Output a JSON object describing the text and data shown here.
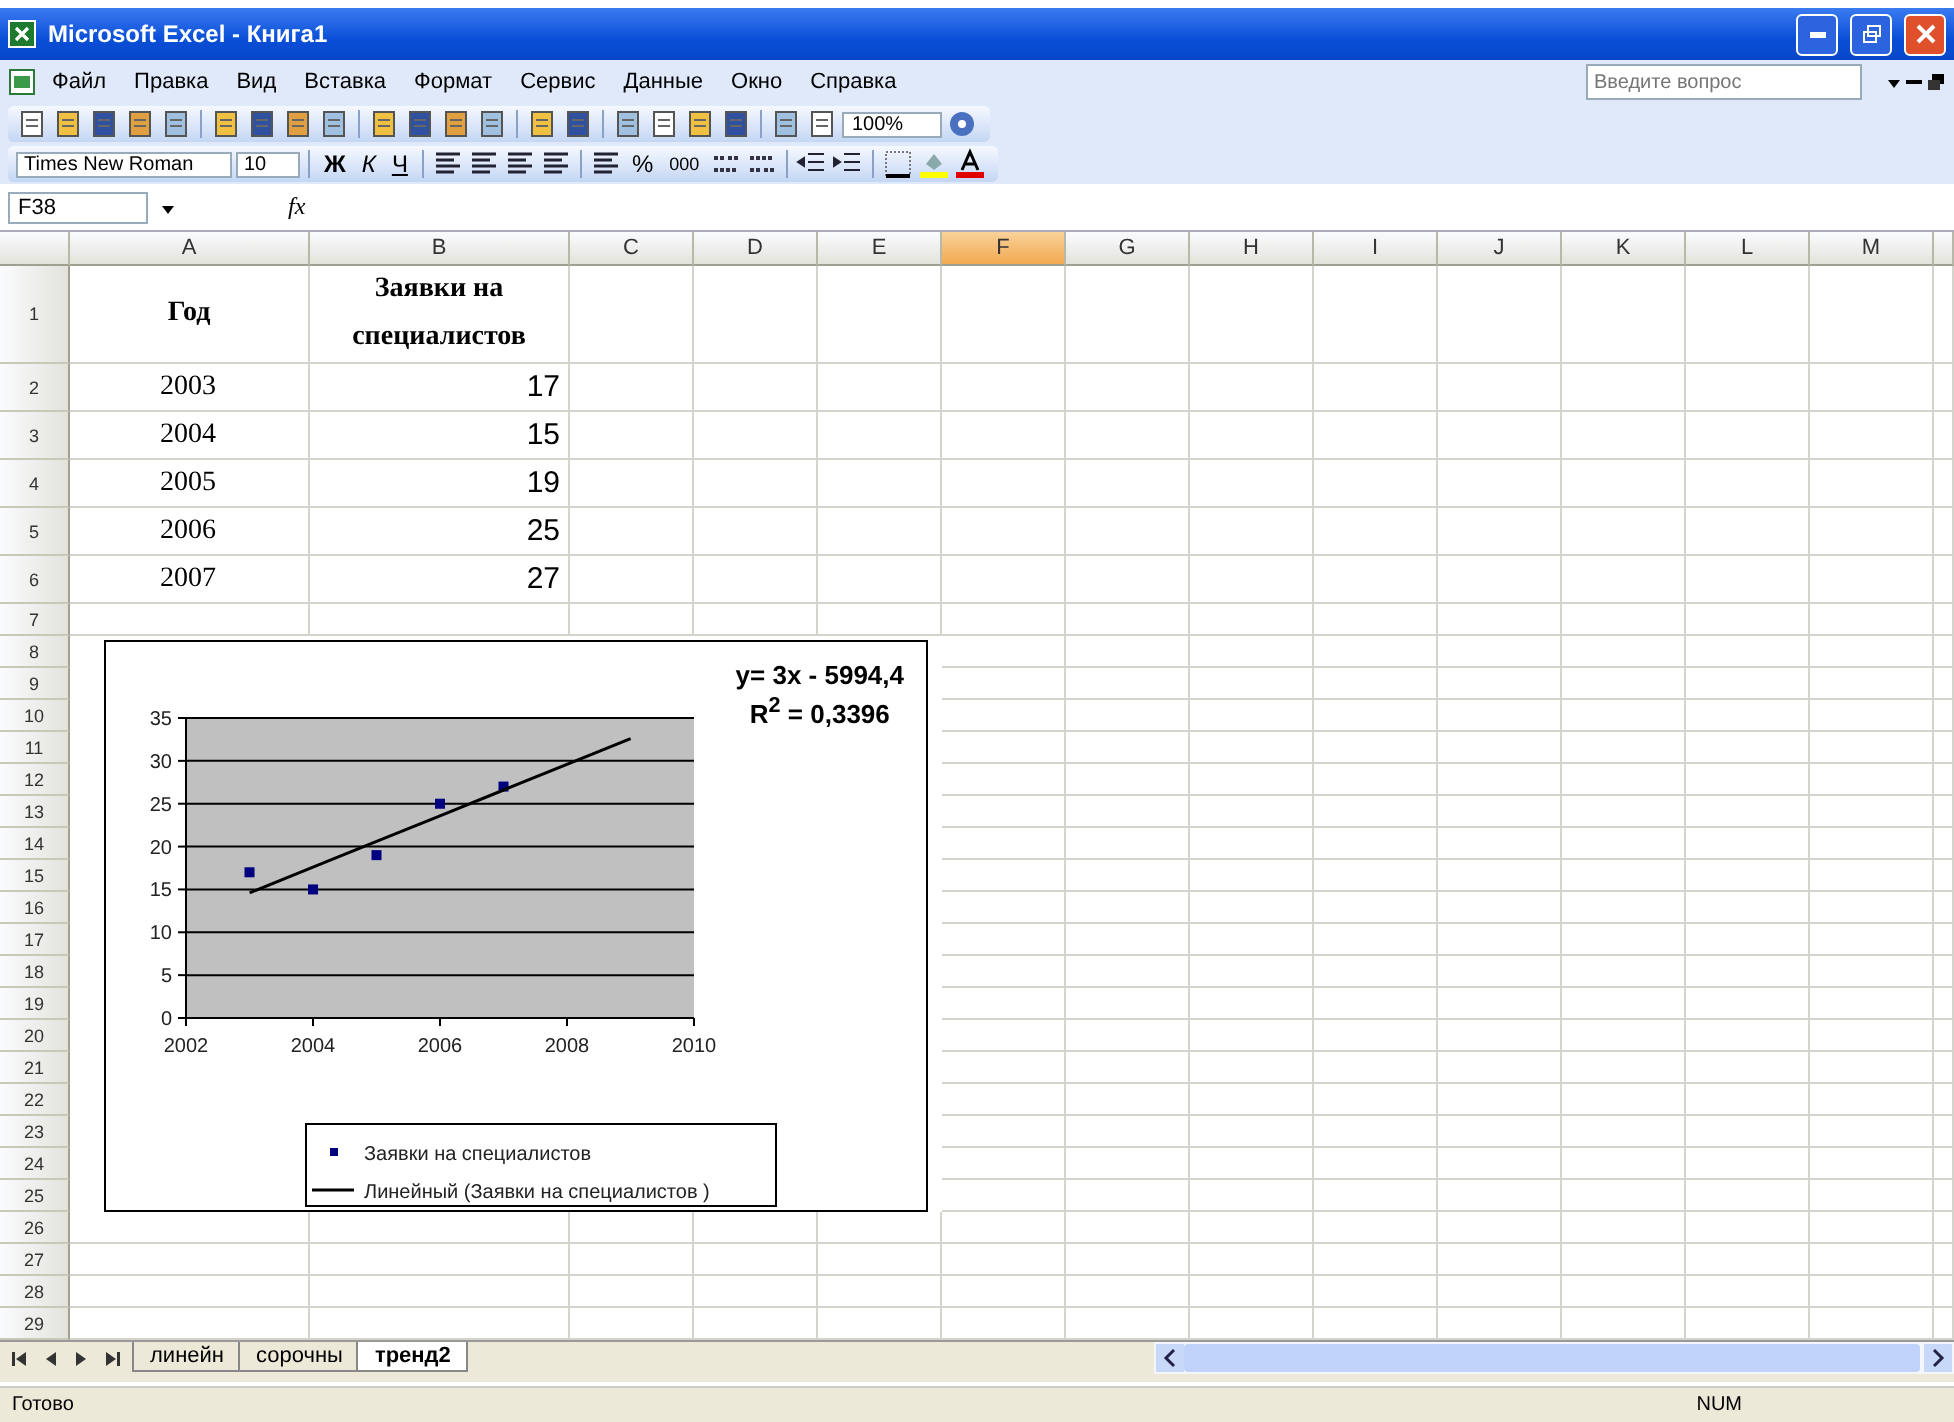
{
  "window": {
    "title": "Microsoft Excel - Книга1"
  },
  "menu": [
    "Файл",
    "Правка",
    "Вид",
    "Вставка",
    "Формат",
    "Сервис",
    "Данные",
    "Окно",
    "Справка"
  ],
  "help_box": {
    "placeholder": "Введите вопрос"
  },
  "standard_toolbar": {
    "zoom": "100%"
  },
  "formatting_toolbar": {
    "font": "Times New Roman",
    "size": "10",
    "bold": "Ж",
    "italic": "К",
    "underline": "Ч",
    "percent": "%",
    "thousands": "000"
  },
  "formula_bar": {
    "name_box": "F38",
    "fx": "fx"
  },
  "columns": [
    {
      "label": "A",
      "selected": false
    },
    {
      "label": "B",
      "selected": false
    },
    {
      "label": "C",
      "selected": false
    },
    {
      "label": "D",
      "selected": false
    },
    {
      "label": "E",
      "selected": false
    },
    {
      "label": "F",
      "selected": true
    },
    {
      "label": "G",
      "selected": false
    },
    {
      "label": "H",
      "selected": false
    },
    {
      "label": "I",
      "selected": false
    },
    {
      "label": "J",
      "selected": false
    },
    {
      "label": "K",
      "selected": false
    },
    {
      "label": "L",
      "selected": false
    },
    {
      "label": "M",
      "selected": false
    }
  ],
  "row_numbers": [
    "1",
    "2",
    "3",
    "4",
    "5",
    "6",
    "7",
    "8",
    "9",
    "10",
    "11",
    "12",
    "13",
    "14",
    "15",
    "16",
    "17",
    "18",
    "19",
    "20",
    "21",
    "22",
    "23",
    "24",
    "25",
    "26",
    "27",
    "28",
    "29"
  ],
  "cells": [
    {
      "kind": "header",
      "a": "Год",
      "b": "Заявки на специалистов"
    },
    {
      "kind": "data",
      "a": "2003",
      "b": "17"
    },
    {
      "kind": "data",
      "a": "2004",
      "b": "15"
    },
    {
      "kind": "data",
      "a": "2005",
      "b": "19"
    },
    {
      "kind": "data",
      "a": "2006",
      "b": "25"
    },
    {
      "kind": "data",
      "a": "2007",
      "b": "27"
    }
  ],
  "chart": {
    "chart_data": {
      "type": "scatter",
      "x": [
        2003,
        2004,
        2005,
        2006,
        2007,
        2009
      ],
      "series": [
        {
          "name": "Заявки на специалистов",
          "type": "scatter",
          "color": "#000080",
          "values": [
            17,
            15,
            19,
            25,
            27,
            null
          ]
        },
        {
          "name": "Линейный (Заявки на специалистов )",
          "type": "line",
          "color": "#000000",
          "values": [
            14.6,
            17.6,
            20.6,
            23.6,
            26.6,
            32.6
          ]
        }
      ],
      "xlim": [
        2002,
        2010
      ],
      "ylim": [
        0,
        35
      ],
      "xticks": [
        2002,
        2004,
        2006,
        2008,
        2010
      ],
      "yticks": [
        0,
        5,
        10,
        15,
        20,
        25,
        30,
        35
      ],
      "grid": true,
      "legend": true,
      "annotations": [
        "y= 3x - 5994,4",
        "R$^{2}$ = 0,3396"
      ]
    }
  },
  "sheet_tabs": [
    {
      "label": "линейн",
      "selected": false
    },
    {
      "label": "сорочны",
      "selected": false
    },
    {
      "label": "тренд2",
      "selected": true
    }
  ],
  "status_bar": {
    "left": "Готово",
    "right": "NUM"
  }
}
